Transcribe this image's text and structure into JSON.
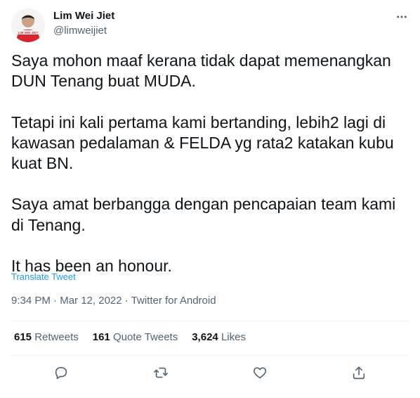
{
  "author": {
    "name": "Lim Wei Jiet",
    "handle": "@limweijiet",
    "avatar_text": "LIM WEI JIET"
  },
  "tweet": {
    "paragraphs": [
      "Saya mohon maaf kerana tidak dapat memenangkan DUN Tenang buat MUDA.",
      "Tetapi ini kali pertama kami bertanding, lebih2 lagi di kawasan pedalaman & FELDA yg rata2 katakan kubu kuat BN.",
      "Saya amat berbangga dengan pencapaian team kami di Tenang.",
      "It has been an honour."
    ],
    "translate_label": "Translate Tweet",
    "time": "9:34 PM",
    "date": "Mar 12, 2022",
    "source": "Twitter for Android",
    "separator": " · "
  },
  "stats": {
    "retweets_count": "615",
    "retweets_label": "Retweets",
    "quotes_count": "161",
    "quotes_label": "Quote Tweets",
    "likes_count": "3,624",
    "likes_label": "Likes"
  },
  "icons": {
    "more": "more-icon",
    "reply": "reply-icon",
    "retweet": "retweet-icon",
    "like": "like-icon",
    "share": "share-icon"
  },
  "colors": {
    "text": "#0f1419",
    "secondary": "#536471",
    "link": "#1d9bf0",
    "divider": "#eff3f4",
    "avatar_red": "#d7262e"
  }
}
